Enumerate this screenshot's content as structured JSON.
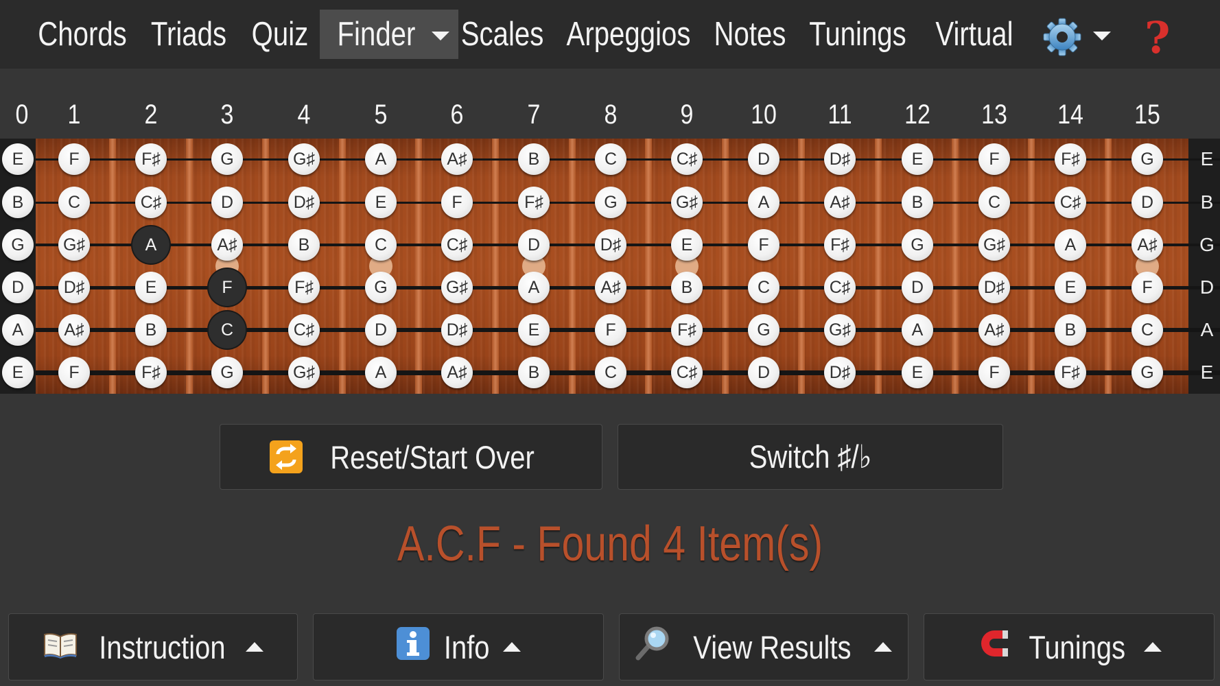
{
  "nav": {
    "items": [
      {
        "label": "Chords",
        "active": false
      },
      {
        "label": "Triads",
        "active": false
      },
      {
        "label": "Quiz",
        "active": false
      },
      {
        "label": "Finder",
        "active": true,
        "dropdown": true
      },
      {
        "label": "Scales",
        "active": false
      },
      {
        "label": "Arpeggios",
        "active": false
      },
      {
        "label": "Notes",
        "active": false
      },
      {
        "label": "Tunings",
        "active": false
      },
      {
        "label": "Virtual",
        "active": false
      }
    ],
    "settings_icon": "gear-icon",
    "help_label": "?",
    "help_color": "#d9302c"
  },
  "fretboard": {
    "fret_numbers": [
      "0",
      "1",
      "2",
      "3",
      "4",
      "5",
      "6",
      "7",
      "8",
      "9",
      "10",
      "11",
      "12",
      "13",
      "14",
      "15"
    ],
    "inlay_frets": [
      3,
      5,
      7,
      9,
      15
    ],
    "strings": [
      {
        "name": "E",
        "notes": [
          "E",
          "F",
          "F♯",
          "G",
          "G♯",
          "A",
          "A♯",
          "B",
          "C",
          "C♯",
          "D",
          "D♯",
          "E",
          "F",
          "F♯",
          "G"
        ]
      },
      {
        "name": "B",
        "notes": [
          "B",
          "C",
          "C♯",
          "D",
          "D♯",
          "E",
          "F",
          "F♯",
          "G",
          "G♯",
          "A",
          "A♯",
          "B",
          "C",
          "C♯",
          "D"
        ]
      },
      {
        "name": "G",
        "notes": [
          "G",
          "G♯",
          "A",
          "A♯",
          "B",
          "C",
          "C♯",
          "D",
          "D♯",
          "E",
          "F",
          "F♯",
          "G",
          "G♯",
          "A",
          "A♯"
        ]
      },
      {
        "name": "D",
        "notes": [
          "D",
          "D♯",
          "E",
          "F",
          "F♯",
          "G",
          "G♯",
          "A",
          "A♯",
          "B",
          "C",
          "C♯",
          "D",
          "D♯",
          "E",
          "F"
        ]
      },
      {
        "name": "A",
        "notes": [
          "A",
          "A♯",
          "B",
          "C",
          "C♯",
          "D",
          "D♯",
          "E",
          "F",
          "F♯",
          "G",
          "G♯",
          "A",
          "A♯",
          "B",
          "C"
        ]
      },
      {
        "name": "E",
        "notes": [
          "E",
          "F",
          "F♯",
          "G",
          "G♯",
          "A",
          "A♯",
          "B",
          "C",
          "C♯",
          "D",
          "D♯",
          "E",
          "F",
          "F♯",
          "G"
        ]
      }
    ],
    "selected": [
      {
        "string": 2,
        "fret": 2
      },
      {
        "string": 3,
        "fret": 3
      },
      {
        "string": 4,
        "fret": 3
      }
    ]
  },
  "buttons": {
    "reset_label": "Reset/Start Over",
    "reset_icon": "repeat-icon",
    "switch_label": "Switch ♯/♭"
  },
  "result": {
    "text": "A.C.F - Found 4 Item(s)",
    "color": "#b8502b"
  },
  "footer": {
    "instruction_label": "Instruction",
    "instruction_icon": "open-book-icon",
    "info_label": "Info",
    "info_icon": "info-icon",
    "results_label": "View Results",
    "results_icon": "magnifier-icon",
    "tunings_label": "Tunings",
    "tunings_icon": "magnet-icon"
  }
}
